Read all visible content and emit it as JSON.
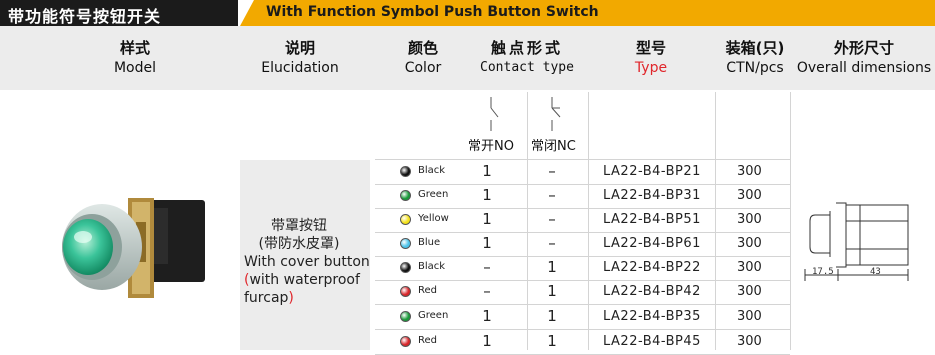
{
  "banner": {
    "title_cn": "带功能符号按钮开关",
    "title_en": "With Function Symbol Push Button Switch"
  },
  "header": {
    "model_cn": "样式",
    "model_en": "Model",
    "desc_cn": "说明",
    "desc_en": "Elucidation",
    "color_cn": "颜色",
    "color_en": "Color",
    "contact_cn": "触点形式",
    "contact_en": "Contact type",
    "type_cn": "型号",
    "type_en": "Type",
    "qty_cn": "装箱(只)",
    "qty_en": "CTN/pcs",
    "dims_cn": "外形尺寸",
    "dims_en": "Overall dimensions"
  },
  "contact": {
    "no_label": "常开NO",
    "nc_label": "常闭NC"
  },
  "description": {
    "line1": "带罩按钮",
    "line2": "(带防水皮罩)",
    "line3": "With cover button",
    "line4_paren": "(",
    "line4": "with waterproof",
    "line5": "furcap",
    "line5_paren": ")"
  },
  "rows": [
    {
      "color": "Black",
      "dot": "#111111",
      "no": "1",
      "nc": "–",
      "type": "LA22-B4-BP21",
      "qty": "300"
    },
    {
      "color": "Green",
      "dot": "#1a9a3a",
      "no": "1",
      "nc": "–",
      "type": "LA22-B4-BP31",
      "qty": "300"
    },
    {
      "color": "Yellow",
      "dot": "#f4e21a",
      "no": "1",
      "nc": "–",
      "type": "LA22-B4-BP51",
      "qty": "300"
    },
    {
      "color": "Blue",
      "dot": "#4cc3ea",
      "no": "1",
      "nc": "–",
      "type": "LA22-B4-BP61",
      "qty": "300"
    },
    {
      "color": "Black",
      "dot": "#111111",
      "no": "–",
      "nc": "1",
      "type": "LA22-B4-BP22",
      "qty": "300"
    },
    {
      "color": "Red",
      "dot": "#d7262a",
      "no": "–",
      "nc": "1",
      "type": "LA22-B4-BP42",
      "qty": "300"
    },
    {
      "color": "Green",
      "dot": "#1a9a3a",
      "no": "1",
      "nc": "1",
      "type": "LA22-B4-BP35",
      "qty": "300"
    },
    {
      "color": "Red",
      "dot": "#d7262a",
      "no": "1",
      "nc": "1",
      "type": "LA22-B4-BP45",
      "qty": "300"
    }
  ],
  "dimensions": {
    "d1": "17.5",
    "d2": "43"
  },
  "colors": {
    "banner_black": "#1b1b1b",
    "banner_yellow": "#f2a900",
    "accent_red": "#e0262b"
  }
}
